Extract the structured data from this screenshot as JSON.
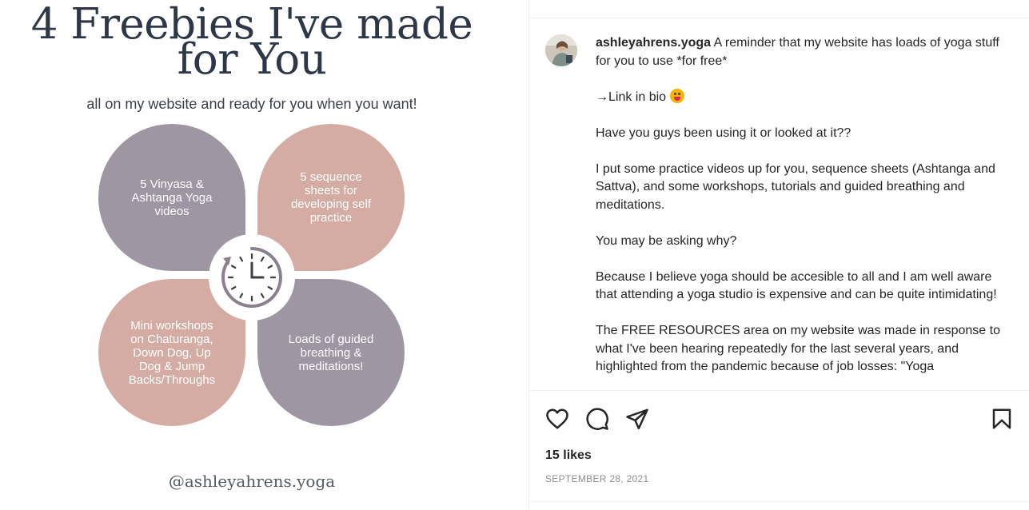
{
  "image": {
    "title_line1": "4 Freebies I've made",
    "title_line2": "for You",
    "subtitle": "all on my website and ready for you when you want!",
    "petals": {
      "top_left": [
        "5 Vinyasa &",
        "Ashtanga Yoga",
        "videos"
      ],
      "top_right": [
        "5 sequence",
        "sheets for",
        "developing self",
        "practice"
      ],
      "bottom_left": [
        "Mini workshops",
        "on Chaturanga,",
        "Down Dog, Up",
        "Dog & Jump",
        "Backs/Throughs"
      ],
      "bottom_right": [
        "Loads of guided",
        "breathing &",
        "meditations!"
      ]
    },
    "center_icon": "clock-icon",
    "handle": "@ashleyahrens.yoga",
    "colors": {
      "mauve": "#9e96a2",
      "blush": "#d4aca3",
      "title": "#2e3747"
    }
  },
  "post": {
    "username": "ashleyahrens.yoga",
    "caption_first": " A reminder that my website has loads of yoga stuff for you to use *for free*",
    "caption_link": "→Link in bio",
    "caption_paragraphs": [
      "Have you guys been using it or looked at it??",
      "I put some practice videos up for you, sequence sheets (Ashtanga and Sattva), and some workshops, tutorials and guided breathing and meditations.",
      "You may be asking why?",
      "Because I believe yoga should be accesible to all and I am well aware that attending a yoga studio is expensive and can be quite intimidating!",
      "The FREE RESOURCES area on my website was made in response to what I've been hearing repeatedly for the last several years, and highlighted from the pandemic because of job losses: \"Yoga"
    ],
    "likes": "15 likes",
    "date": "SEPTEMBER 28, 2021",
    "icons": [
      "heart-icon",
      "comment-icon",
      "share-icon",
      "bookmark-icon"
    ]
  }
}
